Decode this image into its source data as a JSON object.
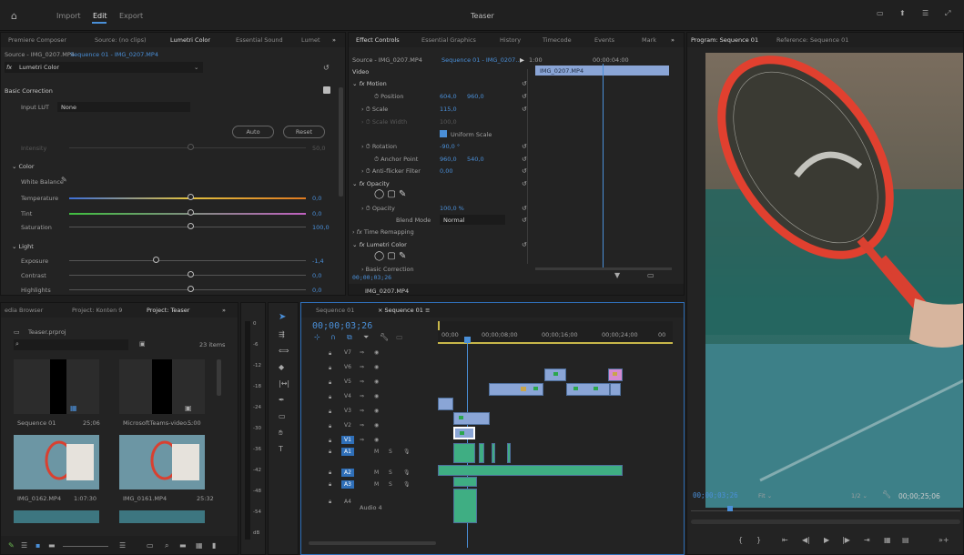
{
  "app": {
    "title": "Teaser",
    "menu": [
      "Import",
      "Edit",
      "Export"
    ],
    "active_menu": "Edit"
  },
  "source_panel": {
    "tabs": [
      "Premiere Composer",
      "Source: (no clips)",
      "Lumetri Color",
      "Essential Sound",
      "Lumet"
    ],
    "active_tab": "Lumetri Color",
    "breadcrumb_source": "Source - IMG_0207.MP4",
    "breadcrumb_sequence": "Sequence 01 - IMG_0207.MP4",
    "effect_name": "Lumetri Color",
    "basic_correction": "Basic Correction",
    "input_lut_label": "Input LUT",
    "input_lut_value": "None",
    "auto_label": "Auto",
    "reset_label": "Reset",
    "intensity_label": "Intensity",
    "intensity_value": "50,0",
    "color_section": "Color",
    "white_balance_label": "White Balance",
    "temperature_label": "Temperature",
    "temperature_value": "0,0",
    "tint_label": "Tint",
    "tint_value": "0,0",
    "saturation_label": "Saturation",
    "saturation_value": "100,0",
    "light_section": "Light",
    "exposure_label": "Exposure",
    "exposure_value": "-1,4",
    "contrast_label": "Contrast",
    "contrast_value": "0,0",
    "highlights_label": "Highlights",
    "highlights_value": "0,0"
  },
  "effect_controls": {
    "tabs": [
      "Effect Controls",
      "Essential Graphics",
      "History",
      "Timecode",
      "Events",
      "Mark"
    ],
    "active_tab": "Effect Controls",
    "source": "Source - IMG_0207.MP4",
    "sequence": "Sequence 01 - IMG_0207...",
    "video_label": "Video",
    "clip_name": "IMG_0207.MP4",
    "ruler_start": "1:00",
    "ruler_mid": "00:00:04:00",
    "motion": "Motion",
    "position_label": "Position",
    "position_x": "604,0",
    "position_y": "960,0",
    "scale_label": "Scale",
    "scale_value": "115,0",
    "scale_width_label": "Scale Width",
    "scale_width_value": "100,0",
    "uniform_scale": "Uniform Scale",
    "rotation_label": "Rotation",
    "rotation_value": "-90,0 °",
    "anchor_label": "Anchor Point",
    "anchor_x": "960,0",
    "anchor_y": "540,0",
    "antiflicker_label": "Anti-flicker Filter",
    "antiflicker_value": "0,00",
    "opacity_section": "Opacity",
    "opacity_label": "Opacity",
    "opacity_value": "100,0 %",
    "blend_label": "Blend Mode",
    "blend_value": "Normal",
    "time_remap": "Time Remapping",
    "lumetri": "Lumetri Color",
    "basic_correction": "Basic Correction",
    "timecode": "00;00;03;26",
    "bottom_clip": "IMG_0207.MP4"
  },
  "program": {
    "tabs": [
      "Program: Sequence 01",
      "Reference: Sequence 01"
    ],
    "active_tab": "Program: Sequence 01",
    "timecode": "00;00;03;26",
    "fit_label": "Fit",
    "resolution": "1/2",
    "duration": "00;00;25;06"
  },
  "project": {
    "tabs": [
      "edia Browser",
      "Project: Konten 9",
      "Project: Teaser"
    ],
    "active_tab": "Project: Teaser",
    "file": "Teaser.prproj",
    "item_count": "23 items",
    "items": [
      {
        "name": "Sequence 01",
        "duration": "25;06"
      },
      {
        "name": "MicrosoftTeams-video...",
        "duration": "5:00"
      },
      {
        "name": "IMG_0162.MP4",
        "duration": "1:07:30"
      },
      {
        "name": "IMG_0161.MP4",
        "duration": "25:32"
      }
    ]
  },
  "timeline": {
    "tabs": [
      "Sequence 01",
      "Sequence 01"
    ],
    "timecode": "00;00;03;26",
    "ruler": [
      "00;00",
      "00;00;08;00",
      "00;00;16;00",
      "00;00;24;00",
      "00"
    ],
    "video_tracks": [
      "V7",
      "V6",
      "V5",
      "V4",
      "V3",
      "V2",
      "V1"
    ],
    "audio_tracks": [
      "A1",
      "A2",
      "A3",
      "A4"
    ],
    "audio4_name": "Audio 4",
    "mute": "M",
    "solo": "S"
  },
  "meter_db": [
    "0",
    "-6",
    "-12",
    "-18",
    "-24",
    "-30",
    "-36",
    "-42",
    "-48",
    "-54",
    "dB"
  ]
}
